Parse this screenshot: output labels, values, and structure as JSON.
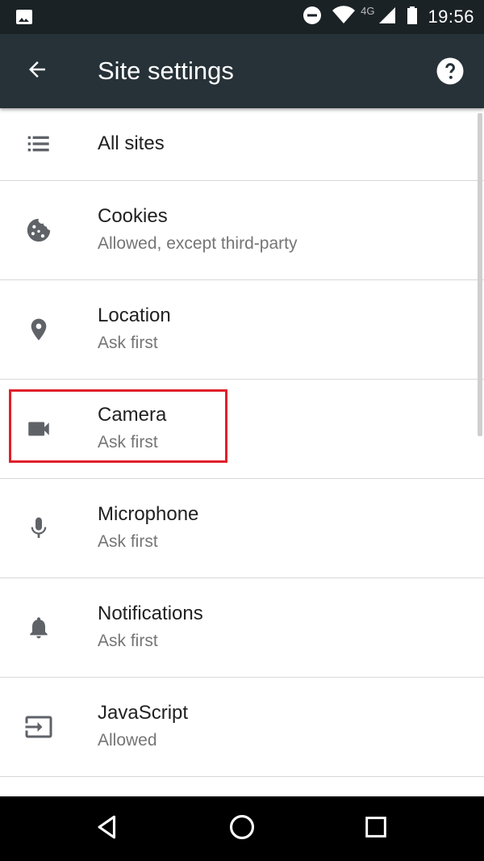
{
  "status_bar": {
    "time": "19:56",
    "network_label": "4G",
    "icons": [
      "image-icon",
      "do-not-disturb-icon",
      "wifi-icon",
      "cellular-signal-icon",
      "battery-icon"
    ]
  },
  "app_bar": {
    "title": "Site settings",
    "back_icon": "arrow-back-icon",
    "help_icon": "help-icon",
    "background_color": "#263238"
  },
  "settings": [
    {
      "title": "All sites",
      "subtitle": "",
      "icon": "list-icon"
    },
    {
      "title": "Cookies",
      "subtitle": "Allowed, except third-party",
      "icon": "cookie-icon"
    },
    {
      "title": "Location",
      "subtitle": "Ask first",
      "icon": "location-pin-icon"
    },
    {
      "title": "Camera",
      "subtitle": "Ask first",
      "icon": "videocam-icon"
    },
    {
      "title": "Microphone",
      "subtitle": "Ask first",
      "icon": "microphone-icon"
    },
    {
      "title": "Notifications",
      "subtitle": "Ask first",
      "icon": "bell-icon"
    },
    {
      "title": "JavaScript",
      "subtitle": "Allowed",
      "icon": "input-arrow-icon"
    }
  ],
  "highlight_color": "#e0202a",
  "nav_bar": {
    "icons": [
      "back-triangle-icon",
      "home-circle-icon",
      "recents-square-icon"
    ]
  }
}
